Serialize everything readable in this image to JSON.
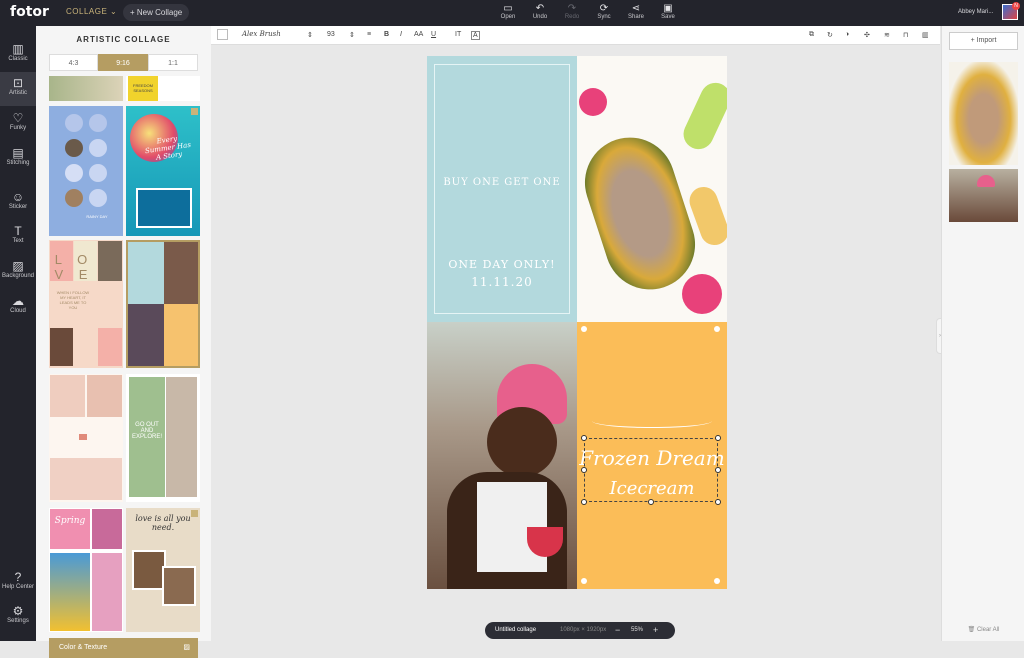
{
  "app": {
    "logo": "fotor",
    "mode": "COLLAGE ⌄",
    "new_collage": "+ New Collage"
  },
  "toolbar": {
    "open": "Open",
    "undo": "Undo",
    "redo": "Redo",
    "sync": "Sync",
    "share": "Share",
    "save": "Save",
    "user": "Abbey Mari...",
    "badge": "N"
  },
  "leftnav": [
    {
      "label": "Classic",
      "icon": "classic-icon"
    },
    {
      "label": "Artistic",
      "icon": "artistic-icon"
    },
    {
      "label": "Funky",
      "icon": "funky-icon"
    },
    {
      "label": "Stitching",
      "icon": "stitching-icon"
    },
    {
      "label": "Sticker",
      "icon": "sticker-icon"
    },
    {
      "label": "Text",
      "icon": "text-icon"
    },
    {
      "label": "Background",
      "icon": "background-icon"
    },
    {
      "label": "Cloud",
      "icon": "cloud-icon"
    },
    {
      "label": "Help Center",
      "icon": "help-icon"
    },
    {
      "label": "Settings",
      "icon": "settings-icon"
    }
  ],
  "panel": {
    "title": "ARTISTIC COLLAGE",
    "ratios": [
      "4:3",
      "9:16",
      "1:1"
    ],
    "selected_ratio": "9:16",
    "color_texture": "Color & Texture",
    "thumb_texts": {
      "freedom": "FREEDOM SEASONS",
      "summer": "Every Summer Has A Story",
      "rainy": "RAINY DAY",
      "love": "L O V E",
      "follow": "WHEN I FOLLOW MY HEART, IT LEADS ME TO YOU",
      "goout": "GO OUT AND EXPLORE!",
      "spring": "Spring",
      "loveall": "love is all you need."
    }
  },
  "editor": {
    "font": "Alex Brush",
    "font_size": "93"
  },
  "collage": {
    "blue_line1": "BUY ONE GET ONE",
    "blue_line2": "ONE DAY ONLY!",
    "blue_line3": "11.11.20",
    "fd_line1": "Frozen Dream",
    "fd_line2": "Icecream"
  },
  "zoombar": {
    "name": "Untitled collage",
    "size": "1080px × 1920px",
    "minus": "−",
    "zoom": "55%",
    "plus": "+"
  },
  "rightpanel": {
    "import": "+ Import",
    "clear_all": "Clear All"
  },
  "colors": {
    "gold": "#b59d62",
    "blue": "#b3d9dd",
    "orange": "#fbbd58",
    "dark": "#23242c"
  }
}
